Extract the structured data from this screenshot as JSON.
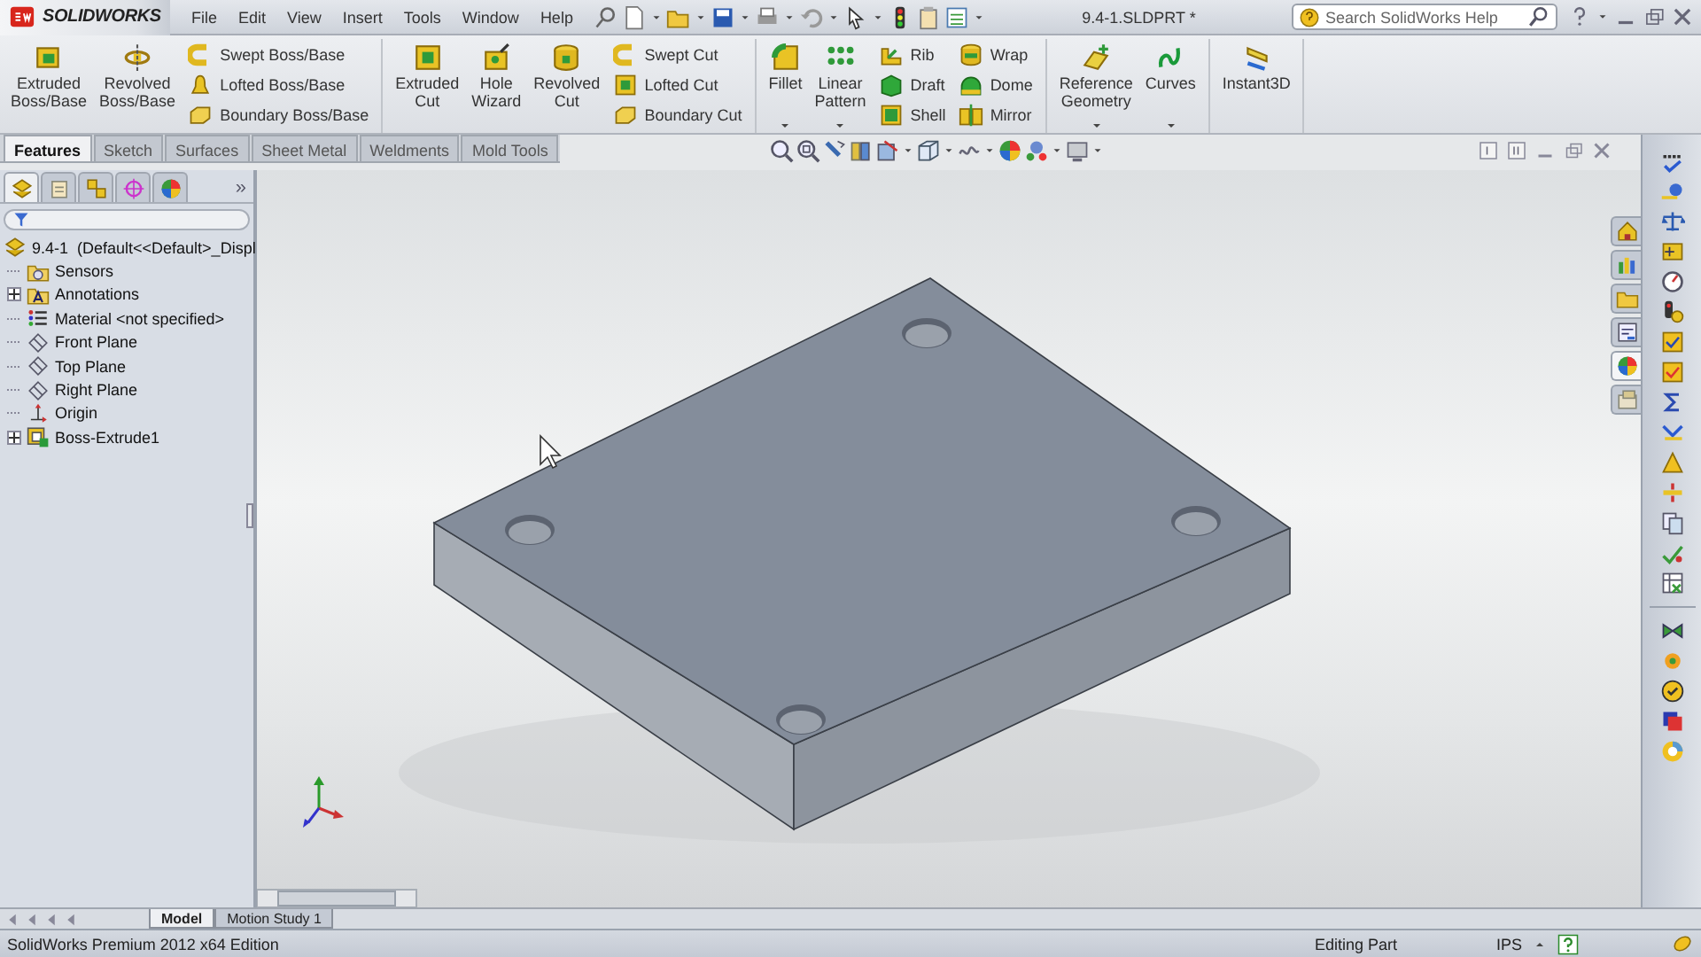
{
  "app": {
    "logo": "SOLIDWORKS"
  },
  "menu": [
    "File",
    "Edit",
    "View",
    "Insert",
    "Tools",
    "Window",
    "Help"
  ],
  "document_title": "9.4-1.SLDPRT *",
  "search": {
    "placeholder": "Search SolidWorks Help"
  },
  "ribbon": {
    "groups": [
      {
        "columns": [
          {
            "kind": "large",
            "label": "Extruded\nBoss/Base",
            "dropdown": false
          },
          {
            "kind": "large",
            "label": "Revolved\nBoss/Base",
            "dropdown": false
          },
          {
            "kind": "stack",
            "items": [
              "Swept Boss/Base",
              "Lofted Boss/Base",
              "Boundary Boss/Base"
            ]
          }
        ]
      },
      {
        "columns": [
          {
            "kind": "large",
            "label": "Extruded\nCut",
            "dropdown": false
          },
          {
            "kind": "large",
            "label": "Hole\nWizard",
            "dropdown": false
          },
          {
            "kind": "large",
            "label": "Revolved\nCut",
            "dropdown": false
          },
          {
            "kind": "stack",
            "items": [
              "Swept Cut",
              "Lofted Cut",
              "Boundary Cut"
            ]
          }
        ]
      },
      {
        "columns": [
          {
            "kind": "large",
            "label": "Fillet",
            "dropdown": true
          },
          {
            "kind": "large",
            "label": "Linear\nPattern",
            "dropdown": true
          },
          {
            "kind": "stack",
            "items": [
              "Rib",
              "Draft",
              "Shell"
            ]
          },
          {
            "kind": "stack",
            "items": [
              "Wrap",
              "Dome",
              "Mirror"
            ]
          }
        ]
      },
      {
        "columns": [
          {
            "kind": "large",
            "label": "Reference\nGeometry",
            "dropdown": true
          },
          {
            "kind": "large",
            "label": "Curves",
            "dropdown": true
          }
        ]
      },
      {
        "columns": [
          {
            "kind": "large",
            "label": "Instant3D",
            "dropdown": false
          }
        ]
      }
    ]
  },
  "tabs": [
    {
      "label": "Features",
      "selected": true
    },
    {
      "label": "Sketch",
      "selected": false
    },
    {
      "label": "Surfaces",
      "selected": false
    },
    {
      "label": "Sheet Metal",
      "selected": false
    },
    {
      "label": "Weldments",
      "selected": false
    },
    {
      "label": "Mold Tools",
      "selected": false
    }
  ],
  "feature_tree": {
    "panel_tabs": [
      {
        "selected": true
      },
      {
        "selected": false
      },
      {
        "selected": false
      },
      {
        "selected": false
      },
      {
        "selected": false
      }
    ],
    "more": "»",
    "root": {
      "label": "9.4-1  (Default<<Default>_Displ",
      "children": [
        {
          "label": "Sensors",
          "kind": "sensors",
          "expandable": false
        },
        {
          "label": "Annotations",
          "kind": "annotations",
          "expandable": true
        },
        {
          "label": "Material <not specified>",
          "kind": "material",
          "expandable": false
        },
        {
          "label": "Front Plane",
          "kind": "plane",
          "expandable": false
        },
        {
          "label": "Top Plane",
          "kind": "plane",
          "expandable": false
        },
        {
          "label": "Right Plane",
          "kind": "plane",
          "expandable": false
        },
        {
          "label": "Origin",
          "kind": "origin",
          "expandable": false
        },
        {
          "label": "Boss-Extrude1",
          "kind": "feature",
          "expandable": true
        }
      ]
    }
  },
  "task_pane_tabs": [
    {
      "selected": false
    },
    {
      "selected": false
    },
    {
      "selected": false
    },
    {
      "selected": false
    },
    {
      "selected": true
    },
    {
      "selected": false
    }
  ],
  "bottom_tabs": [
    {
      "label": "Model",
      "selected": true
    },
    {
      "label": "Motion Study 1",
      "selected": false
    }
  ],
  "status_bar": {
    "product": "SolidWorks Premium 2012 x64 Edition",
    "mode": "Editing Part",
    "units": "IPS"
  }
}
